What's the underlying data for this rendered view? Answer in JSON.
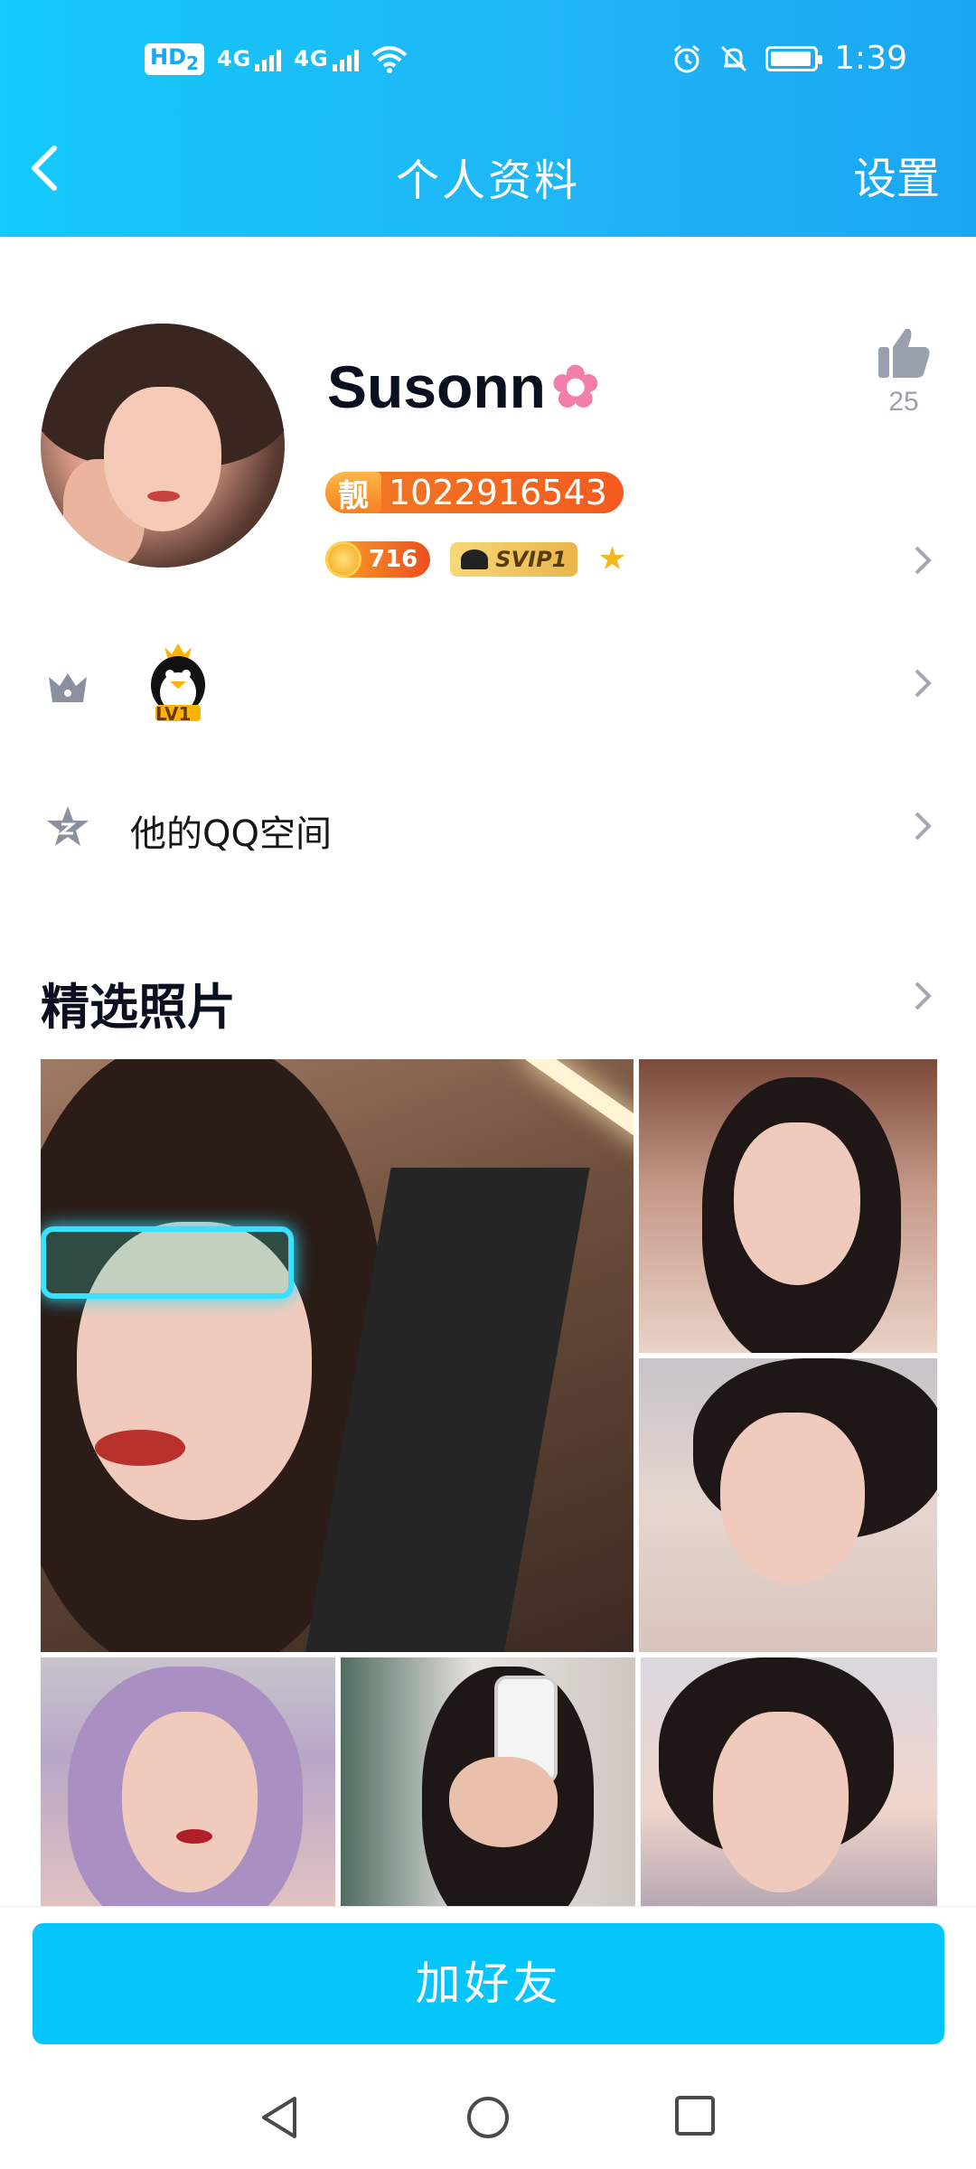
{
  "status_bar": {
    "hd_label": "HD",
    "hd_sim": "2",
    "net1": "4G",
    "net2": "4G",
    "time": "1:39"
  },
  "header": {
    "title": "个人资料",
    "settings_label": "设置"
  },
  "profile": {
    "nickname": "Susonn",
    "pretty_tag": "靓",
    "qq_number": "1022916543",
    "coin_value": "716",
    "vip_label": "SVIP1",
    "likes_count": "25"
  },
  "level_row": {
    "level_label": "LV1"
  },
  "qzone_row": {
    "label": "他的QQ空间"
  },
  "photos": {
    "section_title": "精选照片"
  },
  "actions": {
    "add_friend_label": "加好友"
  },
  "colors": {
    "header_gradient_start": "#14c9fb",
    "header_gradient_end": "#1aa6f3",
    "primary_button": "#05c6fb",
    "qq_pill": "#f55a20"
  }
}
